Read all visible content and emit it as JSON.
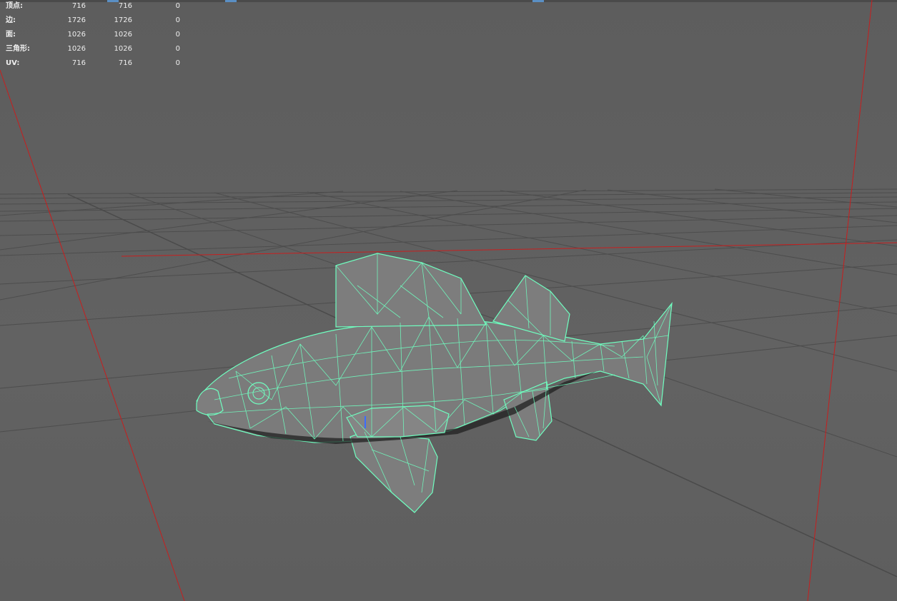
{
  "hud": {
    "rows": [
      {
        "label": "顶点:",
        "c1": "716",
        "c2": "716",
        "c3": "0"
      },
      {
        "label": "边:",
        "c1": "1726",
        "c2": "1726",
        "c3": "0"
      },
      {
        "label": "面:",
        "c1": "1026",
        "c2": "1026",
        "c3": "0"
      },
      {
        "label": "三角形:",
        "c1": "1026",
        "c2": "1026",
        "c3": "0"
      },
      {
        "label": "UV:",
        "c1": "716",
        "c2": "716",
        "c3": "0"
      }
    ]
  },
  "colors": {
    "background": "#5f5f5f",
    "grid": "#4b4b4b",
    "axis_red": "#c81e1e",
    "wireframe": "#6fffc0",
    "mesh_fill": "#7a7a7a"
  },
  "scene": {
    "object": "fish-mesh",
    "display_mode": "wireframe-on-shaded"
  }
}
